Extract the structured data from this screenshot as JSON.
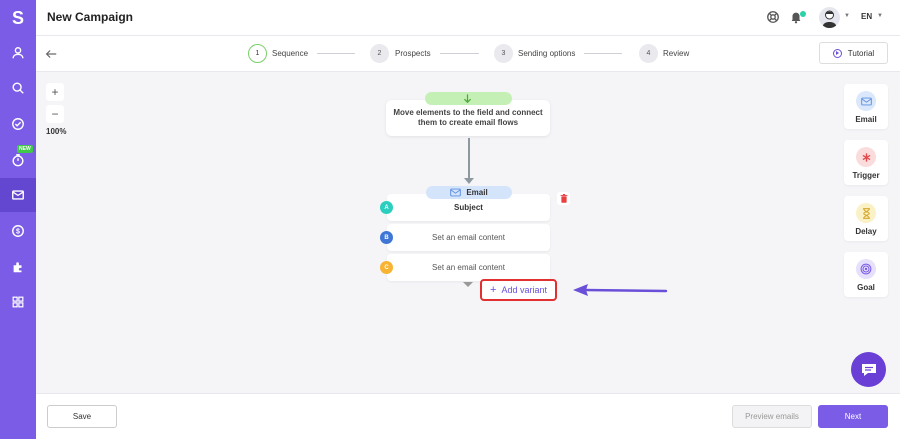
{
  "app": {
    "logo_letter": "S",
    "title": "New Campaign",
    "language": "EN",
    "new_badge": "NEW"
  },
  "sidebar": {
    "items": [
      {
        "icon": "user-icon"
      },
      {
        "icon": "search-icon"
      },
      {
        "icon": "check-circle-icon"
      },
      {
        "icon": "timer-icon",
        "badge": "NEW"
      },
      {
        "icon": "mail-icon",
        "active": true
      },
      {
        "icon": "dollar-icon"
      },
      {
        "icon": "puzzle-icon"
      },
      {
        "icon": "apps-grid-icon"
      }
    ]
  },
  "steps": [
    {
      "number": "1",
      "label": "Sequence",
      "active": true
    },
    {
      "number": "2",
      "label": "Prospects"
    },
    {
      "number": "3",
      "label": "Sending options"
    },
    {
      "number": "4",
      "label": "Review"
    }
  ],
  "toolbar": {
    "tutorial_label": "Tutorial"
  },
  "zoom": {
    "plus": "+",
    "minus": "−",
    "level": "100%"
  },
  "flow": {
    "start_text": "Move elements to the field and connect them to create email flows",
    "email_node_label": "Email",
    "variants": [
      {
        "letter": "A",
        "text": "Subject",
        "color": "#2ccfbf"
      },
      {
        "letter": "B",
        "text": "Set an email content",
        "color": "#3f77d6"
      },
      {
        "letter": "C",
        "text": "Set an email content",
        "color": "#f7b331"
      }
    ],
    "add_variant_label": "Add variant"
  },
  "palette": [
    {
      "label": "Email",
      "icon": "mail-icon",
      "bg": "#dbe8fb",
      "fg": "#5b8fe0"
    },
    {
      "label": "Trigger",
      "icon": "asterisk-icon",
      "bg": "#fbdcdc",
      "fg": "#e04a4a"
    },
    {
      "label": "Delay",
      "icon": "hourglass-icon",
      "bg": "#fbf1c6",
      "fg": "#d5a62a"
    },
    {
      "label": "Goal",
      "icon": "target-icon",
      "bg": "#e6e0fb",
      "fg": "#7b5ce6"
    }
  ],
  "footer": {
    "save_label": "Save",
    "preview_label": "Preview emails",
    "next_label": "Next"
  },
  "colors": {
    "brand": "#7b5ce6",
    "highlight": "#e0302f",
    "arrow": "#6a4fd8"
  }
}
